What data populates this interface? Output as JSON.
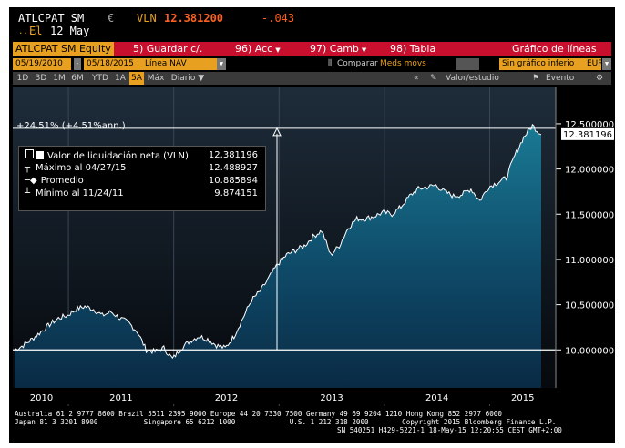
{
  "header": {
    "ticker": "ATLCPAT SM",
    "currency_symbol": "€",
    "vln_label": "VLN",
    "price": "12.381200",
    "change": "-.043",
    "dots": "....",
    "el_label": "El",
    "date": "12 May"
  },
  "menu_bar": {
    "security": "ATLCPAT SM Equity",
    "guardar": "5) Guardar c/.",
    "acc": "96) Acc",
    "camb": "97) Camb",
    "tabla": "98) Tabla",
    "title": "Gráfico de líneas"
  },
  "controls": {
    "start_date": "05/19/2010",
    "end_date": "05/18/2015",
    "series": "Línea NAV",
    "comparar": "Comparar",
    "meds_movs": "Meds móvs",
    "lower_chart": "Sin gráfico inferio",
    "currency": "EUR"
  },
  "period_tabs": [
    "1D",
    "3D",
    "1M",
    "6M",
    "YTD",
    "1A",
    "5A",
    "Máx"
  ],
  "active_period": "5A",
  "frequency": "Diario",
  "right_tools": {
    "valor": "Valor/estudio",
    "evento": "Evento"
  },
  "chart_annotation": "+24.51% (+4.51%ann.)",
  "legend": {
    "nav_label": "Valor de liquidación neta (VLN)",
    "nav_value": "12.381196",
    "max_label": "Máximo al 04/27/15",
    "max_value": "12.488927",
    "avg_label": "Promedio",
    "avg_value": "10.885894",
    "min_label": "Mínimo al 11/24/11",
    "min_value": "9.874151"
  },
  "price_tag": "12.381196",
  "colors": {
    "accent": "#e8a020",
    "menu_red": "#c8102e",
    "price_orange": "#ff6020"
  },
  "chart_data": {
    "type": "area",
    "y_tick_labels": [
      "12.500000",
      "12.000000",
      "11.500000",
      "11.000000",
      "10.500000",
      "10.000000"
    ],
    "y_ticks": [
      12.5,
      12.0,
      11.5,
      11.0,
      10.5,
      10.0
    ],
    "x_tick_labels": [
      "2010",
      "2011",
      "2012",
      "2013",
      "2014",
      "2015"
    ],
    "ylim": [
      9.6,
      12.6
    ],
    "x": [
      "2010-05",
      "2010-06",
      "2010-07",
      "2010-08",
      "2010-09",
      "2010-10",
      "2010-11",
      "2010-12",
      "2011-01",
      "2011-02",
      "2011-03",
      "2011-04",
      "2011-05",
      "2011-06",
      "2011-07",
      "2011-08",
      "2011-09",
      "2011-10",
      "2011-11",
      "2011-12",
      "2012-01",
      "2012-02",
      "2012-03",
      "2012-04",
      "2012-05",
      "2012-06",
      "2012-07",
      "2012-08",
      "2012-09",
      "2012-10",
      "2012-11",
      "2012-12",
      "2013-01",
      "2013-02",
      "2013-03",
      "2013-04",
      "2013-05",
      "2013-06",
      "2013-07",
      "2013-08",
      "2013-09",
      "2013-10",
      "2013-11",
      "2013-12",
      "2014-01",
      "2014-02",
      "2014-03",
      "2014-04",
      "2014-05",
      "2014-06",
      "2014-07",
      "2014-08",
      "2014-09",
      "2014-10",
      "2014-11",
      "2014-12",
      "2015-01",
      "2015-02",
      "2015-03",
      "2015-04",
      "2015-05"
    ],
    "values": [
      10.0,
      10.05,
      10.12,
      10.2,
      10.28,
      10.35,
      10.38,
      10.45,
      10.48,
      10.45,
      10.38,
      10.42,
      10.35,
      10.3,
      10.2,
      10.0,
      9.98,
      10.02,
      9.9,
      10.02,
      10.1,
      10.15,
      10.12,
      10.05,
      10.02,
      10.15,
      10.35,
      10.55,
      10.65,
      10.8,
      10.95,
      11.05,
      11.1,
      11.15,
      11.25,
      11.32,
      11.05,
      11.15,
      11.35,
      11.45,
      11.45,
      11.48,
      11.52,
      11.5,
      11.58,
      11.7,
      11.78,
      11.8,
      11.82,
      11.75,
      11.7,
      11.72,
      11.78,
      11.65,
      11.8,
      11.85,
      11.9,
      12.15,
      12.35,
      12.48,
      12.38
    ],
    "reference_line": 10.0
  }
}
